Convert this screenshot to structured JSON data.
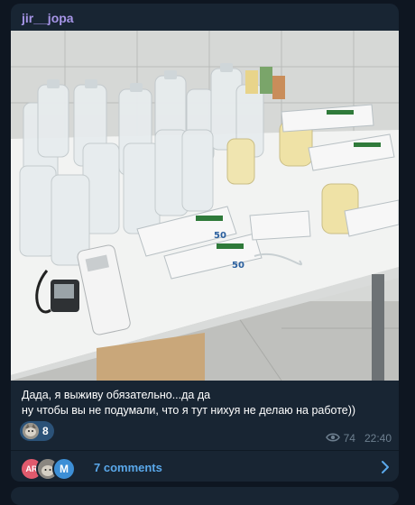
{
  "post": {
    "channel_name": "jir__jopa",
    "caption_line1": "Дада, я выживу обязательно...да да",
    "caption_line2": "ну чтобы вы не подумали, что я тут нихуя не делаю на работе))",
    "reaction_count": "8",
    "views": "74",
    "time": "22:40"
  },
  "comments": {
    "label": "7 comments",
    "avatars": [
      "AR",
      "",
      "M"
    ]
  },
  "photo": {
    "syringe_label": "50",
    "description_icons": [
      "iv-bottle",
      "syringe-pack",
      "air-conditioner-remote",
      "blood-pressure-monitor"
    ]
  },
  "colors": {
    "background": "#0e1621",
    "card": "#182533",
    "channel_name": "#a695e7",
    "link": "#5aa8ea",
    "meta": "#6d7f8f",
    "reaction_bg": "#2b5278"
  }
}
